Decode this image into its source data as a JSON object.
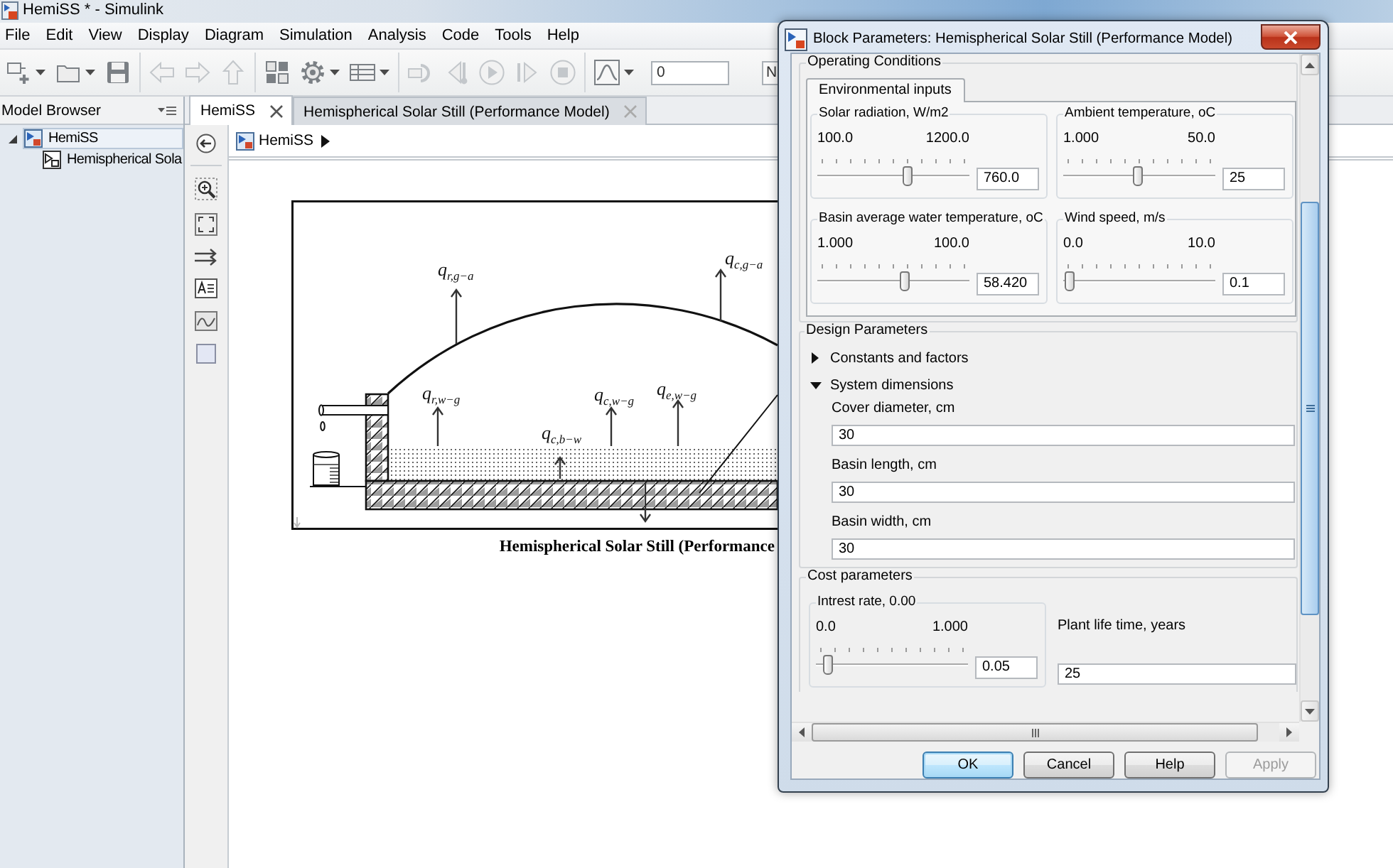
{
  "window": {
    "title": "HemiSS * - Simulink"
  },
  "menu": [
    "File",
    "Edit",
    "View",
    "Display",
    "Diagram",
    "Simulation",
    "Analysis",
    "Code",
    "Tools",
    "Help"
  ],
  "toolbar": {
    "groups": [
      {
        "buttons": [
          {
            "kind": "new",
            "dropdown": true,
            "disabled": false
          },
          {
            "kind": "open",
            "dropdown": true,
            "disabled": false
          },
          {
            "kind": "save",
            "dropdown": false,
            "disabled": false
          }
        ]
      },
      {
        "buttons": [
          {
            "kind": "back",
            "dropdown": false,
            "disabled": true
          },
          {
            "kind": "forward",
            "dropdown": false,
            "disabled": true
          },
          {
            "kind": "up",
            "dropdown": false,
            "disabled": true
          }
        ]
      },
      {
        "buttons": [
          {
            "kind": "library",
            "dropdown": false,
            "disabled": false
          },
          {
            "kind": "gear",
            "dropdown": true,
            "disabled": false
          },
          {
            "kind": "table",
            "dropdown": true,
            "disabled": false
          }
        ]
      },
      {
        "buttons": [
          {
            "kind": "loop",
            "dropdown": false,
            "disabled": true
          },
          {
            "kind": "stepback",
            "dropdown": false,
            "disabled": true
          },
          {
            "kind": "run",
            "dropdown": false,
            "disabled": true
          },
          {
            "kind": "stepforward",
            "dropdown": false,
            "disabled": true
          },
          {
            "kind": "stop",
            "dropdown": false,
            "disabled": true
          }
        ]
      },
      {
        "buttons": [
          {
            "kind": "scope",
            "dropdown": true,
            "disabled": false
          }
        ]
      }
    ],
    "stop_time": "0",
    "mode": "N"
  },
  "model_browser": {
    "title": "Model Browser",
    "tree": [
      {
        "label": "HemiSS",
        "expanded": true,
        "selected": true,
        "children": [
          {
            "label": "Hemispherical Sola",
            "selected": false
          }
        ]
      }
    ]
  },
  "tabs": [
    {
      "label": "HemiSS",
      "selected": true
    },
    {
      "label": "Hemispherical Solar Still (Performance Model)",
      "selected": false
    }
  ],
  "breadcrumb": [
    "HemiSS"
  ],
  "diagram": {
    "labels": [
      "q$_{r,g−a}$",
      "q$_{c,g−a}$",
      "q$_{r,w−g}$",
      "q$_{c,w−g}$",
      "q$_{e,w−g}$",
      "q$_{c,b−w}$"
    ],
    "caption": "Hemispherical Solar Still (Performance"
  },
  "dialog": {
    "title": "Block Parameters: Hemispherical Solar Still (Performance Model)",
    "operating_conditions": {
      "title": "Operating Conditions",
      "tabs": [
        {
          "label": "Environmental inputs",
          "selected": true
        }
      ],
      "sliders": [
        {
          "label": "Solar radiation, W/m2",
          "min": "100.0",
          "max": "1200.0",
          "level": 0.6,
          "value": "760.0"
        },
        {
          "label": "Ambient temperature, oC",
          "min": "1.000",
          "max": "50.0",
          "level": 0.49,
          "value": "25"
        },
        {
          "label": "Basin average water temperature, oC",
          "min": "1.000",
          "max": "100.0",
          "level": 0.58,
          "value": "58.420"
        },
        {
          "label": "Wind speed, m/s",
          "min": "0.0",
          "max": "10.0",
          "level": 0.01,
          "value": "0.1"
        }
      ]
    },
    "design_parameters": {
      "title": "Design Parameters",
      "groups": [
        {
          "label": "Constants and factors",
          "expanded": false
        },
        {
          "label": "System dimensions",
          "expanded": true,
          "fields": [
            {
              "label": "Cover diameter, cm",
              "value": "30"
            },
            {
              "label": "Basin length, cm",
              "value": "30"
            },
            {
              "label": "Basin width, cm",
              "value": "30"
            }
          ]
        }
      ]
    },
    "cost_parameters": {
      "title": "Cost parameters",
      "slider": {
        "label": "Intrest rate, 0.00",
        "min": "0.0",
        "max": "1.000",
        "level": 0.05,
        "value": "0.05"
      },
      "field": {
        "label": "Plant life time, years",
        "value": "25"
      }
    },
    "buttons": [
      {
        "label": "OK",
        "default": true,
        "disabled": false
      },
      {
        "label": "Cancel",
        "default": false,
        "disabled": false
      },
      {
        "label": "Help",
        "default": false,
        "disabled": false
      },
      {
        "label": "Apply",
        "default": false,
        "disabled": true
      }
    ]
  }
}
